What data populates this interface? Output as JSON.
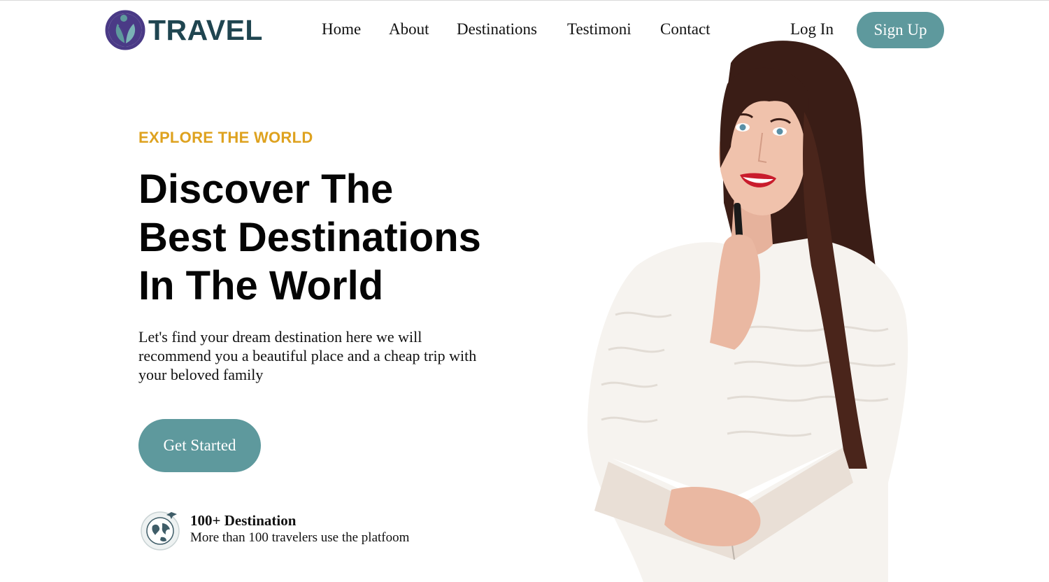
{
  "brand": {
    "name": "TRAVEL",
    "logo_icon": "leaf-person-logo-icon",
    "brand_color": "#1f4550",
    "logo_color": "#4a3a86"
  },
  "nav": {
    "items": [
      {
        "label": "Home"
      },
      {
        "label": "About"
      },
      {
        "label": "Destinations"
      },
      {
        "label": "Testimoni"
      },
      {
        "label": "Contact"
      }
    ],
    "login_label": "Log In",
    "signup_label": "Sign Up"
  },
  "hero": {
    "eyebrow": "EXPLORE THE WORLD",
    "headline_lines": [
      "Discover The",
      "Best Destinations",
      "In The World"
    ],
    "description": "Let's find your dream destination here we will recommend you a beautiful place and a cheap trip with your beloved family",
    "cta_label": "Get Started"
  },
  "stat": {
    "icon": "globe-plane-icon",
    "title": "100+ Destination",
    "subtitle": "More than 100 travelers use the platfoom"
  },
  "colors": {
    "accent": "#5e999d",
    "eyebrow": "#dea21f",
    "text": "#111111"
  }
}
